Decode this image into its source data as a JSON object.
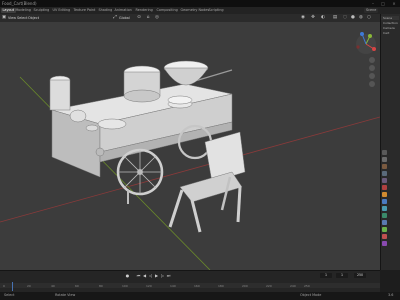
{
  "window": {
    "title": "Food_Cart(Blend)"
  },
  "menubar": {
    "workspaces": [
      "Layout",
      "Modeling",
      "Sculpting",
      "UV Editing",
      "Texture Paint",
      "Shading",
      "Animation",
      "Rendering",
      "Compositing",
      "Geometry Nodes",
      "Scripting"
    ],
    "active_workspace": "Layout",
    "scene": "Scene"
  },
  "header": {
    "mode": "Object Mode",
    "view": "View",
    "select": "Select",
    "add": "Add",
    "object": "Object",
    "transform_orientation": "Global"
  },
  "viewport": {
    "gizmo_labels": {
      "x": "X",
      "y": "Y",
      "z": "Z"
    }
  },
  "outliner": {
    "collection": "Scene",
    "items": [
      "Collection",
      "Camera",
      "Cart"
    ]
  },
  "properties": {
    "icons": [
      "tool-icon",
      "render-icon",
      "output-icon",
      "view-layer-icon",
      "scene-icon",
      "world-icon",
      "object-icon",
      "modifier-icon",
      "particles-icon",
      "physics-icon",
      "constraints-icon",
      "data-icon",
      "material-icon",
      "texture-icon"
    ]
  },
  "timeline": {
    "current_frame": "1",
    "start": "1",
    "end": "250",
    "ticks": [
      "0",
      "20",
      "40",
      "60",
      "80",
      "100",
      "120",
      "140",
      "160",
      "180",
      "200",
      "220",
      "240",
      "250"
    ]
  },
  "status": {
    "left": "Select",
    "middle": "Rotate View",
    "right": "Object Mode",
    "version": "3.6"
  },
  "colors": {
    "accent": "#4772b3",
    "background": "#3c3c3c",
    "grid_x": "#8a3a3a",
    "grid_y": "#6a8a2a"
  }
}
